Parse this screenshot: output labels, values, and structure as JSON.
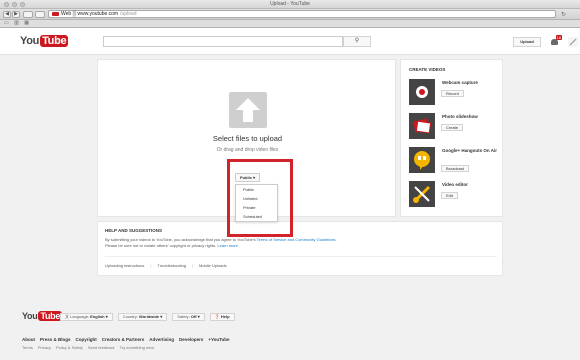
{
  "window": {
    "title": "Upload - YouTube"
  },
  "browser": {
    "back_icon": "◀",
    "forward_icon": "▶",
    "url_host": "Web ▒ www.youtube.com",
    "url_path": "/upload",
    "reload_icon": "↻",
    "bookmarks_icons": "▭ ▥ ▦"
  },
  "header": {
    "logo_you": "You",
    "logo_tube": "Tube",
    "guide_icon": "≡",
    "search_placeholder": "",
    "search_icon": "⚲",
    "upload_label": "Upload",
    "notification_count": "18"
  },
  "upload": {
    "title": "Select files to upload",
    "hint": "Or drag and drop video files",
    "privacy_value": "Public ▾",
    "privacy_options": [
      "Public",
      "Unlisted",
      "Private",
      "Scheduled"
    ],
    "highlight_color": "#d2232a"
  },
  "help": {
    "title": "HELP AND SUGGESTIONS",
    "text_1": "By submitting your videos to YouTube, you acknowledge that you agree to YouTube's",
    "text_link": "Terms of Service and Community Guidelines.",
    "text_2": "Please be sure not to violate others' copyright or privacy rights.",
    "text_link_2": "Learn more",
    "links": [
      "Uploading instructions",
      "Troubleshooting",
      "Mobile Uploads"
    ]
  },
  "create": {
    "title": "CREATE VIDEOS",
    "tools": [
      {
        "name": "Webcam capture",
        "button": "Record",
        "icon": "webcam-icon"
      },
      {
        "name": "Photo slideshow",
        "button": "Create",
        "icon": "slideshow-icon"
      },
      {
        "name": "Google+ Hangouts On Air",
        "button": "Broadcast",
        "icon": "hangouts-icon"
      },
      {
        "name": "Video editor",
        "button": "Edit",
        "icon": "video-editor-icon"
      }
    ]
  },
  "footer": {
    "logo_you": "You",
    "logo_tube": "Tube",
    "language_label": "Language:",
    "language_value": "English ▾",
    "country_label": "Country:",
    "country_value": "Worldwide ▾",
    "safety_label": "Safety:",
    "safety_value": "Off ▾",
    "help_label": "Help",
    "links": [
      "About",
      "Press & Blogs",
      "Copyright",
      "Creators & Partners",
      "Advertising",
      "Developers",
      "+YouTube"
    ],
    "sublinks": [
      "Terms",
      "Privacy",
      "Policy & Safety",
      "Send feedback",
      "Try something new!"
    ]
  }
}
